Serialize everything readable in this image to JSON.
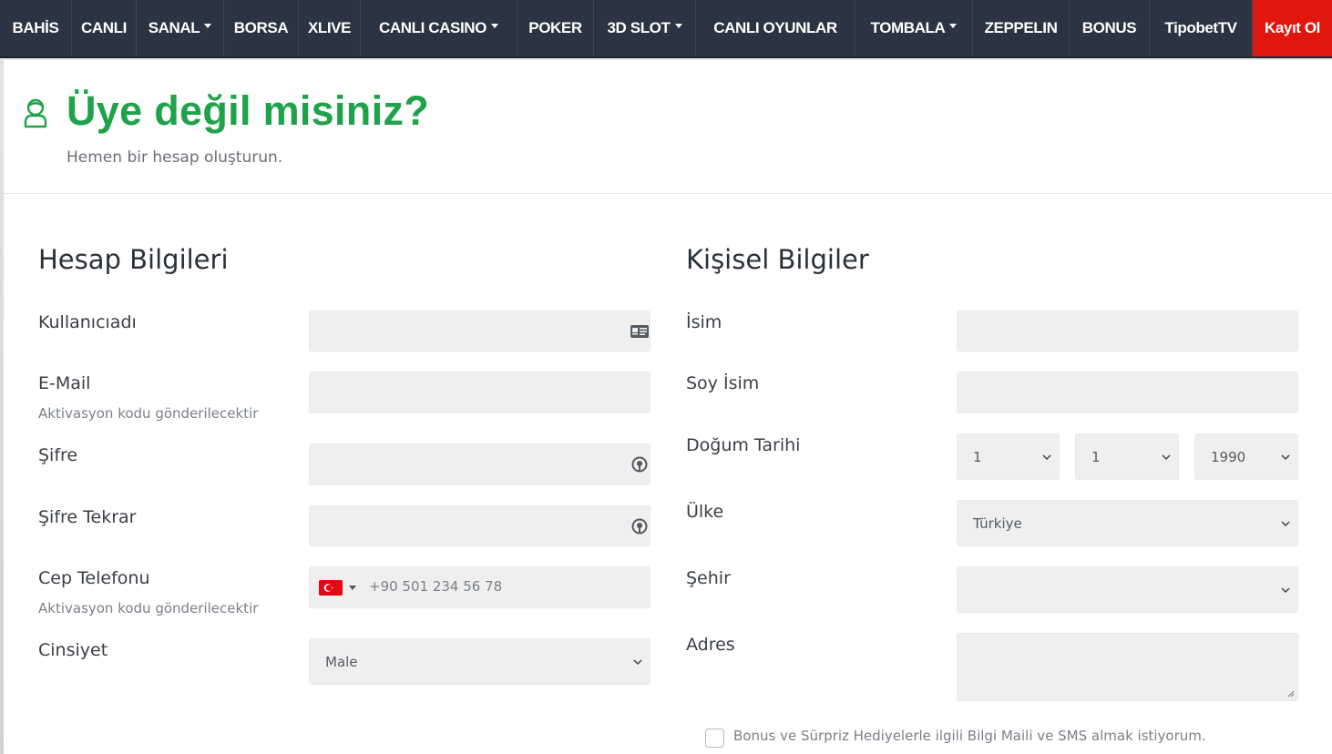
{
  "nav": {
    "items": [
      {
        "label": "BAHİS",
        "dropdown": false
      },
      {
        "label": "CANLI",
        "dropdown": false
      },
      {
        "label": "SANAL",
        "dropdown": true
      },
      {
        "label": "BORSA",
        "dropdown": false
      },
      {
        "label": "XLIVE",
        "dropdown": false
      },
      {
        "label": "CANLI CASINO",
        "dropdown": true
      },
      {
        "label": "POKER",
        "dropdown": false
      },
      {
        "label": "3D SLOT",
        "dropdown": true
      },
      {
        "label": "CANLI OYUNLAR",
        "dropdown": false
      },
      {
        "label": "TOMBALA",
        "dropdown": true
      },
      {
        "label": "ZEPPELIN",
        "dropdown": false
      },
      {
        "label": "BONUS",
        "dropdown": false
      },
      {
        "label": "TipobetTV",
        "dropdown": false
      }
    ],
    "register_label": "Kayıt Ol"
  },
  "header": {
    "title": "Üye değil misiniz?",
    "subtitle": "Hemen bir hesap oluşturun."
  },
  "account": {
    "section_title": "Hesap Bilgileri",
    "username_label": "Kullanıcıadı",
    "email_label": "E-Mail",
    "email_help": "Aktivasyon kodu gönderilecektir",
    "password_label": "Şifre",
    "password_repeat_label": "Şifre Tekrar",
    "phone_label": "Cep Telefonu",
    "phone_placeholder": "+90 501 234 56 78",
    "phone_help": "Aktivasyon kodu gönderilecektir",
    "gender_label": "Cinsiyet",
    "gender_value": "Male"
  },
  "personal": {
    "section_title": "Kişisel Bilgiler",
    "first_name_label": "İsim",
    "last_name_label": "Soy İsim",
    "birthdate_label": "Doğum Tarihi",
    "birth_day": "1",
    "birth_month": "1",
    "birth_year": "1990",
    "country_label": "Ülke",
    "country_value": "Türkiye",
    "city_label": "Şehir",
    "city_value": "",
    "address_label": "Adres",
    "consent_label": "Bonus ve Sürpriz Hediyelerle ilgili Bilgi Maili ve SMS almak istiyorum."
  },
  "colors": {
    "navbar": "#2a3442",
    "register": "#e0160f",
    "accent_green": "#1fa24a"
  }
}
